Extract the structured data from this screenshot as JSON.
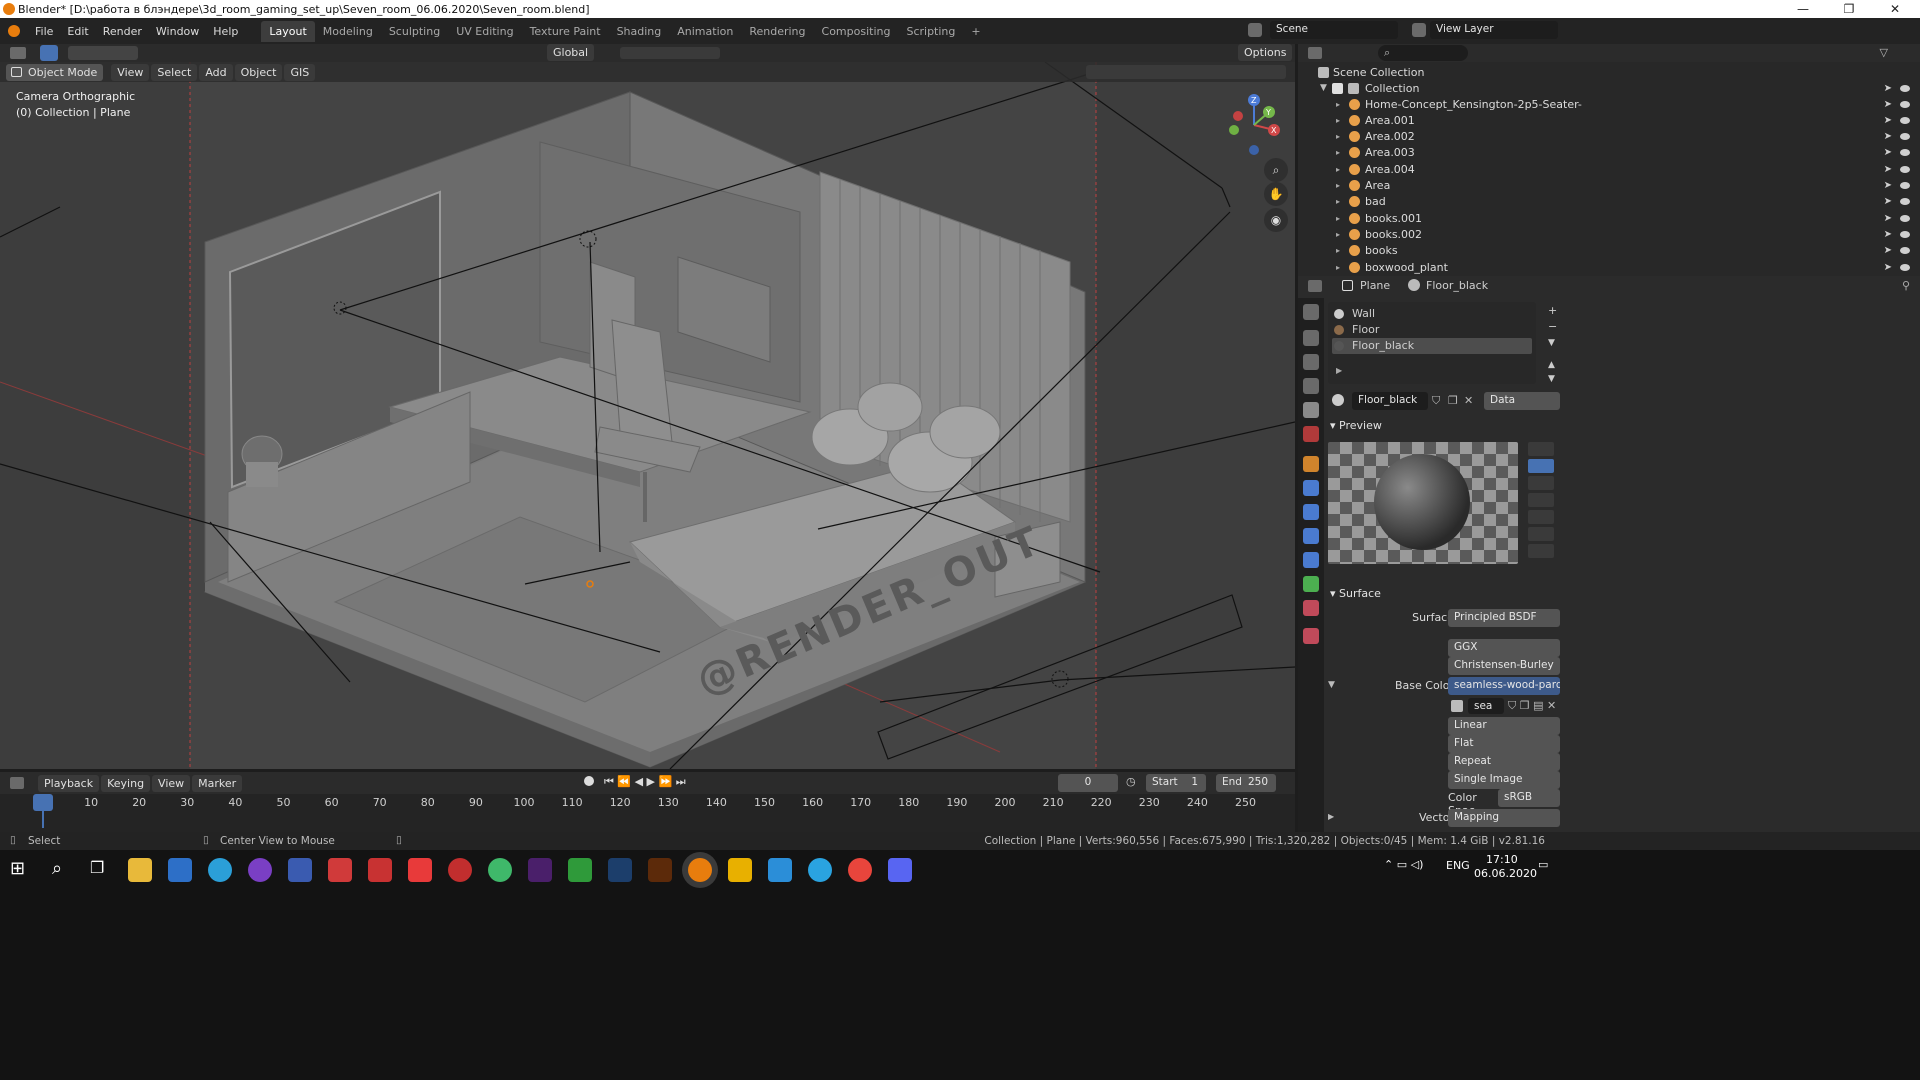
{
  "title": "Blender* [D:\\работа в блэндере\\3d_room_gaming_set_up\\Seven_room_06.06.2020\\Seven_room.blend]",
  "window_controls": {
    "minimize": "—",
    "maximize": "❐",
    "close": "✕"
  },
  "menu": [
    "File",
    "Edit",
    "Render",
    "Window",
    "Help"
  ],
  "workspaces": [
    "Layout",
    "Modeling",
    "Sculpting",
    "UV Editing",
    "Texture Paint",
    "Shading",
    "Animation",
    "Rendering",
    "Compositing",
    "Scripting"
  ],
  "workspace_add": "+",
  "scene": {
    "name": "Scene",
    "view_layer": "View Layer"
  },
  "viewport": {
    "mode": "Object Mode",
    "header_menus": [
      "View",
      "Select",
      "Add",
      "Object",
      "GIS"
    ],
    "transform_orientation": "Global",
    "options_label": "Options",
    "camera_label": "Camera Orthographic",
    "collection_label": "(0) Collection | Plane",
    "watermark": "@RENDER_OUT"
  },
  "outliner": {
    "scene_collection": "Scene Collection",
    "collection": "Collection",
    "items": [
      {
        "name": "Home-Concept_Kensington-2p5-Seater-",
        "icon": "armature-icon"
      },
      {
        "name": "Area.001",
        "icon": "light-icon"
      },
      {
        "name": "Area.002",
        "icon": "light-icon"
      },
      {
        "name": "Area.003",
        "icon": "light-icon"
      },
      {
        "name": "Area.004",
        "icon": "light-icon"
      },
      {
        "name": "Area",
        "icon": "light-icon"
      },
      {
        "name": "bad",
        "icon": "mesh-icon"
      },
      {
        "name": "books.001",
        "icon": "mesh-icon"
      },
      {
        "name": "books.002",
        "icon": "mesh-icon"
      },
      {
        "name": "books",
        "icon": "mesh-icon"
      },
      {
        "name": "boxwood_plant",
        "icon": "mesh-icon"
      }
    ]
  },
  "properties": {
    "breadcrumb_object": "Plane",
    "breadcrumb_material": "Floor_black",
    "material_slots": [
      "Wall",
      "Floor",
      "Floor_black"
    ],
    "active_slot": "Floor_black",
    "material_name": "Floor_black",
    "link": "Data",
    "preview_label": "Preview",
    "surface_section": "Surface",
    "surface_label": "Surface",
    "surface_value": "Principled BSDF",
    "distribution": "GGX",
    "subsurface_method": "Christensen-Burley",
    "base_color_label": "Base Color",
    "base_color_value": "seamless-wood-parq...",
    "image_name": "sea",
    "interpolation": "Linear",
    "projection": "Flat",
    "extension": "Repeat",
    "source": "Single Image",
    "color_space_label": "Color Spac",
    "color_space_value": "sRGB",
    "vector_label": "Vector",
    "vector_value": "Mapping"
  },
  "timeline": {
    "menus": [
      "Playback",
      "Keying",
      "View",
      "Marker"
    ],
    "current_frame": "0",
    "start_label": "Start",
    "start": "1",
    "end_label": "End",
    "end": "250",
    "ticks": [
      "0",
      "10",
      "20",
      "30",
      "40",
      "50",
      "60",
      "70",
      "80",
      "90",
      "100",
      "110",
      "120",
      "130",
      "140",
      "150",
      "160",
      "170",
      "180",
      "190",
      "200",
      "210",
      "220",
      "230",
      "240",
      "250"
    ]
  },
  "statusbar": {
    "left": "Select",
    "middle": "Center View to Mouse",
    "stats": "Collection | Plane | Verts:960,556 | Faces:675,990 | Tris:1,320,282 | Objects:0/45 | Mem: 1.4 GiB | v2.81.16"
  },
  "taskbar": {
    "language": "ENG",
    "time": "17:10",
    "date": "06.06.2020"
  },
  "colors": {
    "accent": "#4772b3",
    "viewport_bg": "#3d3d3d",
    "panel_bg": "#2b2b2b",
    "blender_orange": "#e87d0d"
  }
}
